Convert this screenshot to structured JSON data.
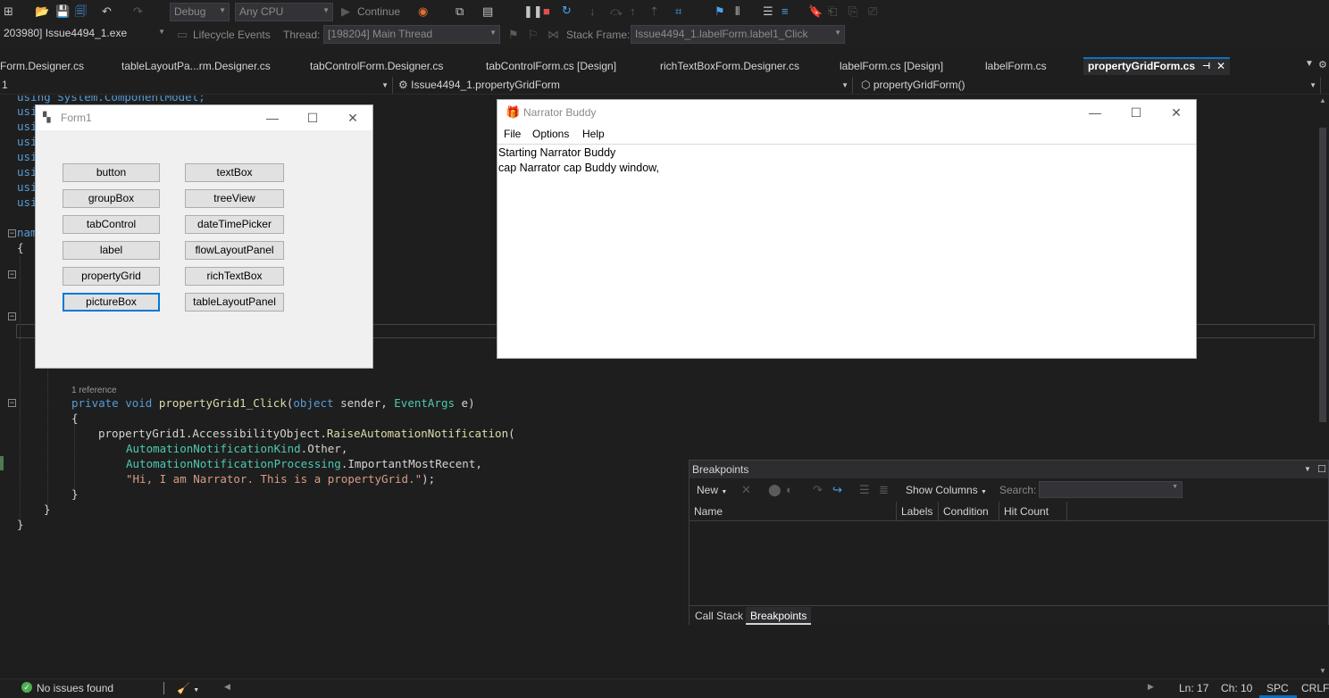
{
  "toolbar": {
    "config_combo": "Debug",
    "platform_combo": "Any CPU",
    "continue_label": "Continue"
  },
  "debug_toolbar": {
    "process_combo": "203980] Issue4494_1.exe",
    "lifecycle_label": "Lifecycle Events",
    "thread_label": "Thread:",
    "thread_combo": "[198204] Main Thread",
    "stack_frame_label": "Stack Frame:",
    "stack_frame_combo": "Issue4494_1.labelForm.label1_Click"
  },
  "tabs": [
    {
      "label": "Form.Designer.cs"
    },
    {
      "label": "tableLayoutPa...rm.Designer.cs"
    },
    {
      "label": "tabControlForm.Designer.cs"
    },
    {
      "label": "tabControlForm.cs [Design]"
    },
    {
      "label": "richTextBoxForm.Designer.cs"
    },
    {
      "label": "labelForm.cs [Design]"
    },
    {
      "label": "labelForm.cs"
    },
    {
      "label": "propertyGridForm.cs",
      "active": true
    }
  ],
  "navbar": {
    "project": "1",
    "class": "Issue4494_1.propertyGridForm",
    "member": "propertyGridForm()"
  },
  "editor": {
    "usings_top": "using System.ComponentModel;",
    "using_prefix": "usi",
    "namespace_prefix": "nam",
    "reference_hint": "1 reference",
    "method_signature": {
      "kw1": "private",
      "kw2": "void",
      "name": "propertyGrid1_Click",
      "open": "(",
      "kw3": "object",
      "p1": " sender, ",
      "type": "EventArgs",
      "p2": " e)"
    },
    "body_line1_obj": "propertyGrid1",
    "body_line1_prop": "AccessibilityObject",
    "body_line1_fn": "RaiseAutomationNotification",
    "body_line2_type": "AutomationNotificationKind",
    "body_line2_val": "Other",
    "body_line3_type": "AutomationNotificationProcessing",
    "body_line3_val": "ImportantMostRecent",
    "body_line4_str": "\"Hi, I am Narrator. This is a propertyGrid.\""
  },
  "form1": {
    "title": "Form1",
    "buttons_left": [
      "button",
      "groupBox",
      "tabControl",
      "label",
      "propertyGrid",
      "pictureBox"
    ],
    "buttons_right": [
      "textBox",
      "treeView",
      "dateTimePicker",
      "flowLayoutPanel",
      "richTextBox",
      "tableLayoutPanel"
    ]
  },
  "narrator": {
    "title": "Narrator Buddy",
    "menu": [
      "File",
      "Options",
      "Help"
    ],
    "log": [
      "Starting Narrator Buddy",
      "cap Narrator cap Buddy window,"
    ]
  },
  "breakpoints": {
    "title": "Breakpoints",
    "new_label": "New",
    "show_columns_label": "Show Columns",
    "search_label": "Search:",
    "columns": [
      "Name",
      "Labels",
      "Condition",
      "Hit Count"
    ],
    "tabs": [
      "Call Stack",
      "Breakpoints"
    ]
  },
  "status": {
    "issues": "No issues found",
    "line": "Ln: 17",
    "col": "Ch: 10",
    "spc": "SPC",
    "crlf": "CRLF"
  }
}
